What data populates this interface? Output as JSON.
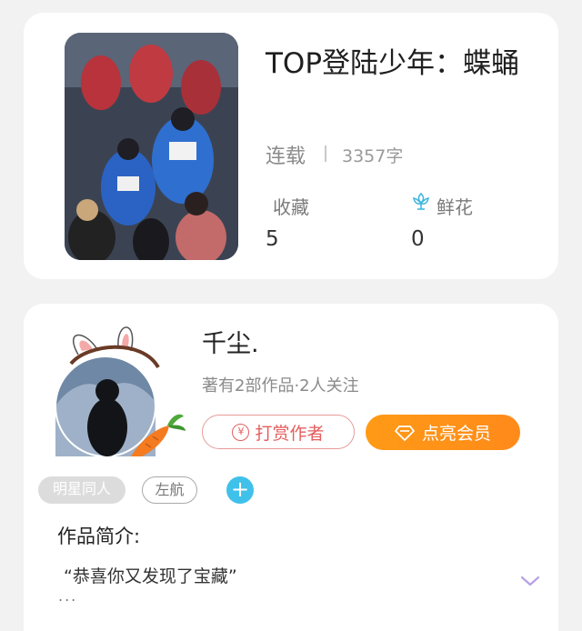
{
  "book": {
    "title": "TOP登陆少年：蝶蛹",
    "status": "连载",
    "word_count": "3357字",
    "favorites_label": "收藏",
    "favorites_value": "5",
    "flowers_label": "鲜花",
    "flowers_value": "0"
  },
  "author": {
    "name": "千尘.",
    "meta": "著有2部作品·2人关注",
    "reward_label": "打赏作者",
    "reward_icon": "¥",
    "vip_label": "点亮会员"
  },
  "tags": {
    "primary": "明星同人",
    "secondary": "左航",
    "add": "+"
  },
  "intro": {
    "heading": "作品简介:",
    "text": "“恭喜你又发现了宝藏”",
    "ellipsis": "..."
  },
  "colors": {
    "accent_orange": "#ff9416",
    "reward_red": "#e45e5e",
    "add_blue": "#3fc1ea",
    "expand_purple": "#b9a0e6"
  },
  "icons": [
    "flower-icon",
    "yen-icon",
    "diamond-icon",
    "plus-icon",
    "chevron-down-icon",
    "bunny-ears-icon",
    "carrot-icon"
  ]
}
